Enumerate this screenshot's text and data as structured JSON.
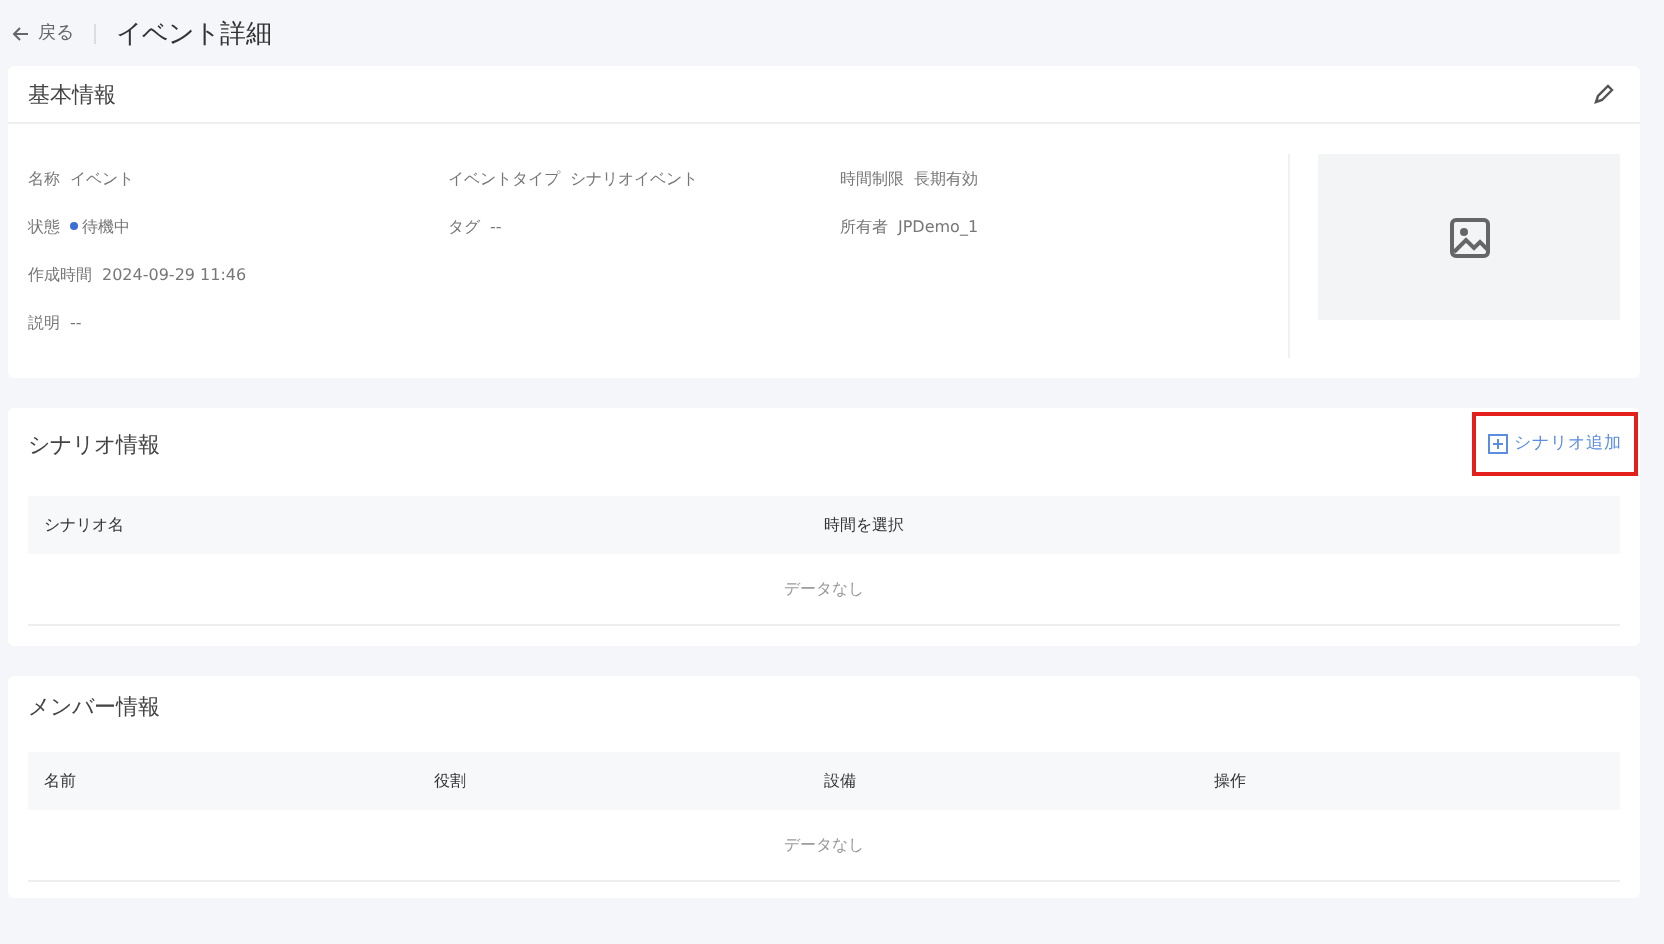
{
  "header": {
    "back": "戻る",
    "title": "イベント詳細"
  },
  "basic_info": {
    "title": "基本情報",
    "rows": [
      [
        {
          "label": "名称",
          "value": "イベント",
          "kind": "text"
        },
        {
          "label": "イベントタイプ",
          "value": "シナリオイベント",
          "kind": "text"
        },
        {
          "label": "時間制限",
          "value": "長期有効",
          "kind": "text"
        }
      ],
      [
        {
          "label": "状態",
          "value": "待機中",
          "kind": "status",
          "color": "#3b6fd6"
        },
        {
          "label": "タグ",
          "value": "--",
          "kind": "text"
        },
        {
          "label": "所有者",
          "value": "JPDemo_1",
          "kind": "text"
        }
      ],
      [
        {
          "label": "作成時間",
          "value": "2024-09-29 11:46",
          "kind": "text"
        }
      ],
      [
        {
          "label": "説明",
          "value": "--",
          "kind": "text"
        }
      ]
    ]
  },
  "scenario_info": {
    "title": "シナリオ情報",
    "add_button": {
      "label": "シナリオ追加",
      "highlighted": true
    },
    "table": {
      "columns": [
        "シナリオ名",
        "時間を選択"
      ],
      "empty": "データなし"
    }
  },
  "member_info": {
    "title": "メンバー情報",
    "table": {
      "columns": [
        "名前",
        "役割",
        "設備",
        "操作"
      ],
      "empty": "データなし"
    }
  }
}
